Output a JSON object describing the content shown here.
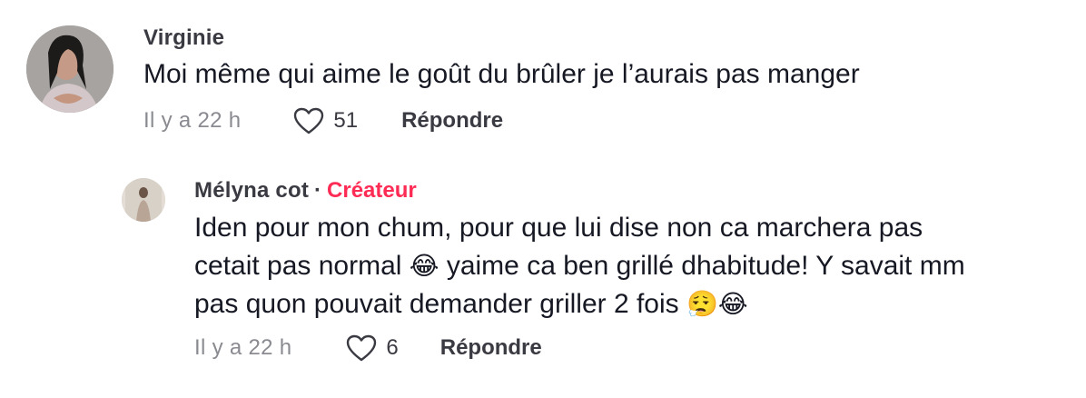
{
  "comments": [
    {
      "author": "Virginie",
      "text": "Moi même qui aime le goût du brûler je l’aurais pas manger",
      "time": "Il y a 22 h",
      "likes": "51",
      "reply_label": "Répondre",
      "icons": {
        "like": "heart-outline-icon"
      }
    },
    {
      "author": "Mélyna cot",
      "separator": "·",
      "badge": "Créateur",
      "badge_color": "#fe2c55",
      "text_line1": "Iden pour mon chum, pour que lui dise non ca marchera pas",
      "text_line2_a": "cetait pas normal ",
      "emoji_laugh": "😂",
      "text_line2_b": " yaime ca ben grillé dhabitude! Y savait mm",
      "text_line3": "pas quon pouvait demander griller 2 fois ",
      "emoji_sigh": "😮‍💨",
      "emoji_laugh2": "😂",
      "time": "Il y a 22 h",
      "likes": "6",
      "reply_label": "Répondre",
      "icons": {
        "like": "heart-outline-icon"
      }
    }
  ]
}
